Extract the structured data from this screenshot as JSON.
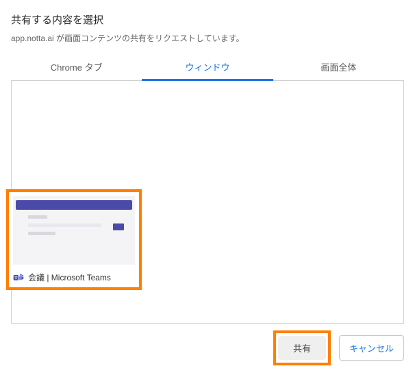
{
  "dialog": {
    "title": "共有する内容を選択",
    "subtitle": "app.notta.ai が画面コンテンツの共有をリクエストしています。"
  },
  "tabs": {
    "chrome_tab": "Chrome タブ",
    "window": "ウィンドウ",
    "entire_screen": "画面全体",
    "active": "window"
  },
  "windows": [
    {
      "label": "会議 | Microsoft Teams",
      "icon": "teams-icon"
    }
  ],
  "footer": {
    "share": "共有",
    "cancel": "キャンセル"
  },
  "highlights": {
    "color": "#ff7f00"
  }
}
